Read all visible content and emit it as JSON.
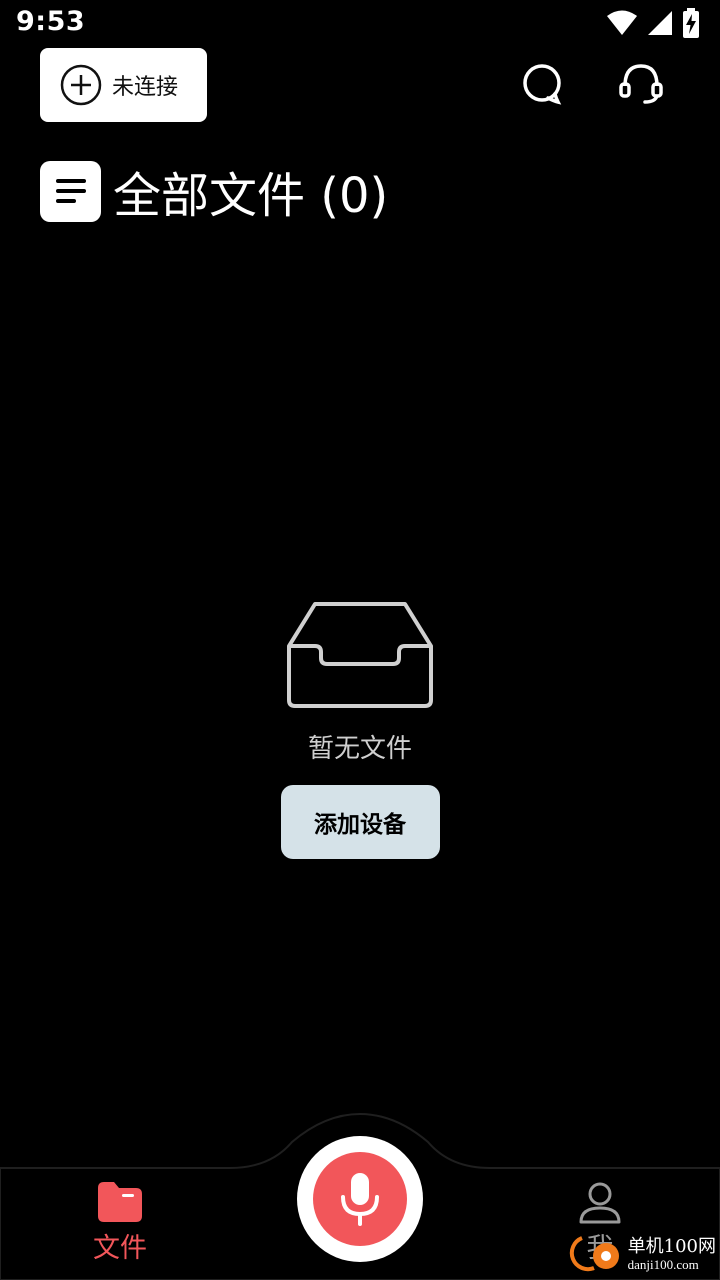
{
  "status_bar": {
    "time": "9:53",
    "icons": [
      "wifi-icon",
      "cellular-signal-icon",
      "battery-charging-icon"
    ]
  },
  "header": {
    "connect_button": {
      "icon": "plus-circle-icon",
      "label": "未连接"
    },
    "search_icon": "search-icon",
    "support_icon": "headset-icon"
  },
  "title": {
    "icon": "document-list-icon",
    "text": "全部文件 (0)"
  },
  "empty_state": {
    "icon": "empty-inbox-icon",
    "message": "暂无文件",
    "button_label": "添加设备"
  },
  "bottom_nav": {
    "items": [
      {
        "label": "文件",
        "icon": "folder-icon",
        "active": true
      },
      {
        "label": "我",
        "icon": "person-icon",
        "active": false
      }
    ],
    "record_button_icon": "microphone-icon"
  },
  "watermark": {
    "cn": "单机100网",
    "en": "danji100.com"
  },
  "colors": {
    "background": "#000000",
    "accent": "#f2565a",
    "button_light": "#d5e2e8",
    "inactive": "#9a9a9a"
  }
}
